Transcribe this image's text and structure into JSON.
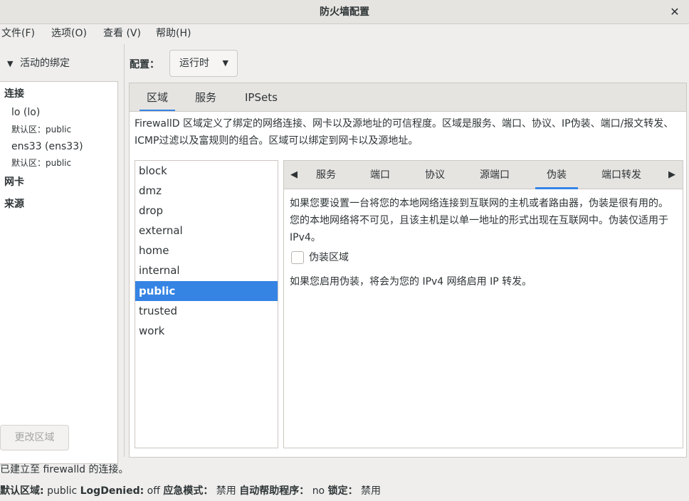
{
  "window": {
    "title": "防火墙配置"
  },
  "menu": [
    "文件(F)",
    "选项(O)",
    "查看 (V)",
    "帮助(H)"
  ],
  "left": {
    "header": "活动的绑定",
    "connections_label": "连接",
    "connections": [
      {
        "name": "lo (lo)",
        "zone": "默认区：public"
      },
      {
        "name": "ens33 (ens33)",
        "zone": "默认区：public"
      }
    ],
    "nic_label": "网卡",
    "source_label": "来源",
    "change_zone_button": "更改区域"
  },
  "config": {
    "label": "配置：",
    "value": "运行时"
  },
  "tabs": [
    "区域",
    "服务",
    "IPSets"
  ],
  "description": "FirewallD 区域定义了绑定的网络连接、网卡以及源地址的可信程度。区域是服务、端口、协议、IP伪装、端口/报文转发、ICMP过滤以及富规则的组合。区域可以绑定到网卡以及源地址。",
  "zones": [
    "block",
    "dmz",
    "drop",
    "external",
    "home",
    "internal",
    "public",
    "trusted",
    "work"
  ],
  "selected_zone": "public",
  "zone_tabs": [
    "服务",
    "端口",
    "协议",
    "源端口",
    "伪装",
    "端口转发"
  ],
  "active_zone_tab": "伪装",
  "masquerade": {
    "info": "如果您要设置一台将您的本地网络连接到互联网的主机或者路由器，伪装是很有用的。您的本地网络将不可见，且该主机是以单一地址的形式出现在互联网中。伪装仅适用于 IPv4。",
    "checkbox_label": "伪装区域",
    "checked": false,
    "note": "如果您启用伪装，将会为您的 IPv4 网络启用 IP 转发。"
  },
  "status": {
    "connection": "已建立至 firewalld 的连接。",
    "default_zone_label": "默认区域:",
    "default_zone_value": "public",
    "logdenied_label": "LogDenied:",
    "logdenied_value": "off",
    "panic_label": "应急模式：",
    "panic_value": "禁用",
    "helper_label": "自动帮助程序：",
    "helper_value": "no",
    "lock_label": "锁定：",
    "lock_value": "禁用"
  },
  "colors": {
    "accent": "#3584e4"
  }
}
